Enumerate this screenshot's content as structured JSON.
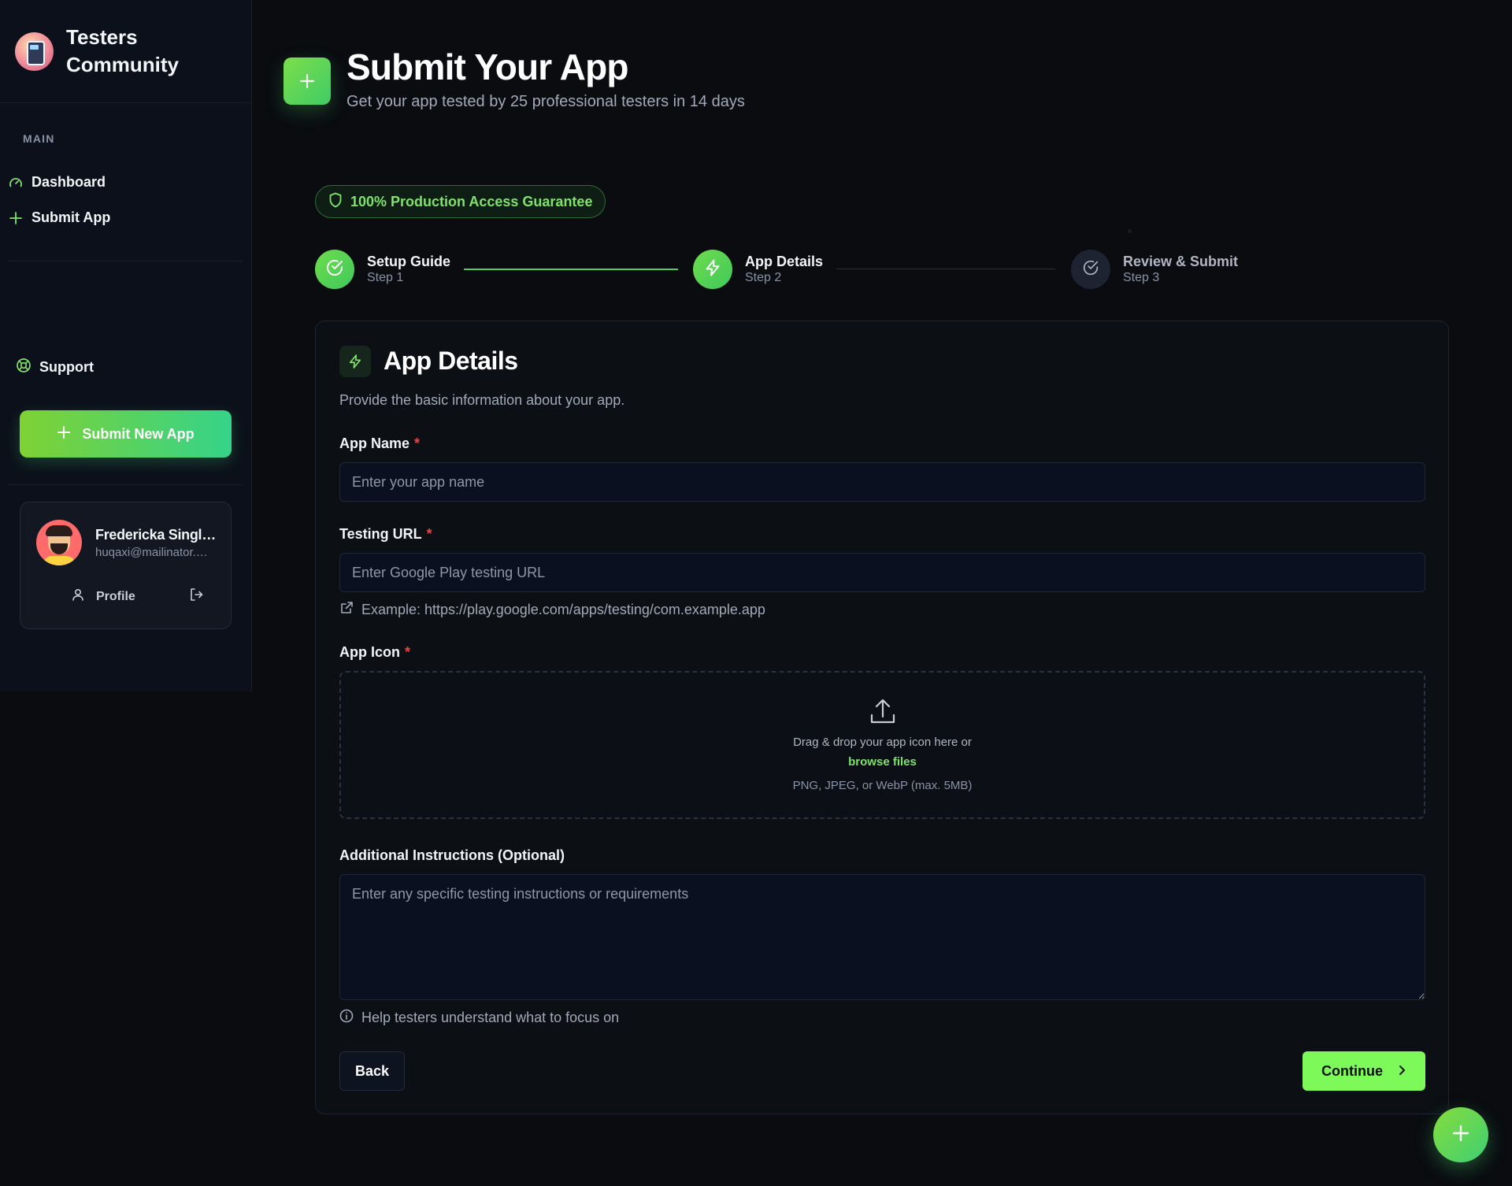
{
  "brand": {
    "name_line1": "Testers",
    "name_line2": "Community"
  },
  "sidebar": {
    "section_label": "MAIN",
    "items": [
      {
        "label": "Dashboard",
        "icon": "gauge-icon"
      },
      {
        "label": "Submit App",
        "icon": "plus-icon"
      }
    ],
    "support_label": "Support",
    "submit_new_label": "Submit New App",
    "user": {
      "name": "Fredericka Singleton",
      "email": "huqaxi@mailinator.com",
      "profile_label": "Profile"
    }
  },
  "header": {
    "title": "Submit Your App",
    "subtitle": "Get your app tested by 25 professional testers in 14 days"
  },
  "badge": {
    "label": "100% Production Access Guarantee"
  },
  "stepper": {
    "steps": [
      {
        "title": "Setup Guide",
        "sub": "Step 1",
        "state": "done"
      },
      {
        "title": "App Details",
        "sub": "Step 2",
        "state": "active"
      },
      {
        "title": "Review & Submit",
        "sub": "Step 3",
        "state": "pending"
      }
    ]
  },
  "form": {
    "title": "App Details",
    "description": "Provide the basic information about your app.",
    "app_name": {
      "label": "App Name",
      "required_mark": "*",
      "value": "",
      "placeholder": "Enter your app name"
    },
    "testing_url": {
      "label": "Testing URL",
      "required_mark": "*",
      "value": "",
      "placeholder": "Enter Google Play testing URL",
      "hint": "Example: https://play.google.com/apps/testing/com.example.app"
    },
    "app_icon": {
      "label": "App Icon",
      "required_mark": "*",
      "drop_text": "Drag & drop your app icon here or",
      "browse_text": "browse files",
      "formats": "PNG, JPEG, or WebP (max. 5MB)"
    },
    "instructions": {
      "label": "Additional Instructions (Optional)",
      "value": "",
      "placeholder": "Enter any specific testing instructions or requirements",
      "hint": "Help testers understand what to focus on"
    },
    "back_label": "Back",
    "continue_label": "Continue"
  },
  "colors": {
    "accent": "#7dfa5a",
    "accent_text": "#7ee26b",
    "background": "#0a0c10",
    "required": "#ef4444"
  }
}
